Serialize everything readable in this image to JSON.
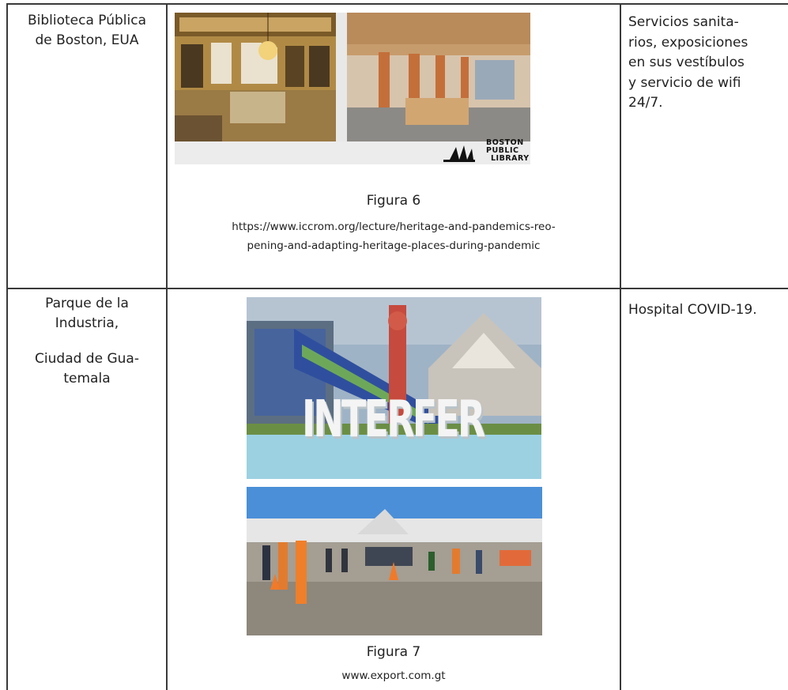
{
  "rows": [
    {
      "place_lines": [
        "Biblioteca Pública",
        "de Boston, EUA"
      ],
      "figure": {
        "logo_lines": [
          "BOSTON",
          "PUBLIC",
          "LIBRARY"
        ],
        "title": "Figura 6",
        "source_lines": [
          "https://www.iccrom.org/lecture/heritage-and-pandemics-reo-",
          "pening-and-adapting-heritage-places-during-pandemic"
        ]
      },
      "use_lines": [
        "Servicios sanita-",
        "rios,  exposiciones",
        "en sus vestíbulos",
        "y servicio de wifi",
        "24/7."
      ]
    },
    {
      "place_lines": [
        "Parque de la",
        "Industria,",
        "Ciudad de Gua-",
        "temala"
      ],
      "figure": {
        "sign_text": "INTERFER",
        "title": "Figura 7",
        "source_lines": [
          "www.export.com.gt"
        ]
      },
      "use_lines": [
        "Hospital COVID-19."
      ]
    }
  ],
  "colors": {
    "border": "#3a3a3a",
    "text": "#222222"
  }
}
